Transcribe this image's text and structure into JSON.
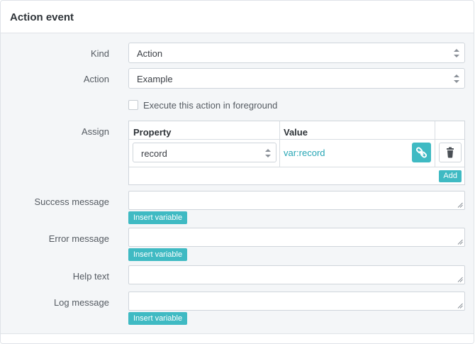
{
  "panel": {
    "title": "Action event"
  },
  "form": {
    "kind": {
      "label": "Kind",
      "value": "Action"
    },
    "action": {
      "label": "Action",
      "value": "Example"
    },
    "foreground": {
      "label": "Execute this action in foreground",
      "checked": false
    },
    "assign": {
      "label": "Assign",
      "columns": [
        "Property",
        "Value"
      ],
      "rows": [
        {
          "property": "record",
          "value": "var:record"
        }
      ],
      "add_label": "Add"
    },
    "success_message": {
      "label": "Success message",
      "value": "",
      "insert_label": "Insert variable"
    },
    "error_message": {
      "label": "Error message",
      "value": "",
      "insert_label": "Insert variable"
    },
    "help_text": {
      "label": "Help text",
      "value": ""
    },
    "log_message": {
      "label": "Log message",
      "value": "",
      "insert_label": "Insert variable"
    }
  },
  "icons": {
    "link": "link-icon",
    "trash": "trash-icon",
    "select_caret": "sort-caret-icon",
    "resize": "resize-grip-icon"
  },
  "colors": {
    "accent": "#3fbac3",
    "link_text": "#25a5b4",
    "panel_bg": "#f4f6f8",
    "border": "#cfd5db"
  }
}
